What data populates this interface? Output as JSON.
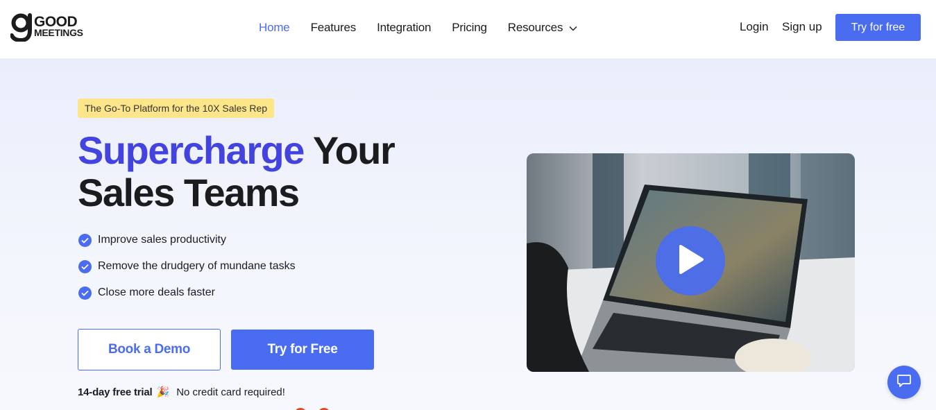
{
  "brand": {
    "line1": "GOOD",
    "line2": "MEETINGS",
    "icon": "g-logo-icon"
  },
  "nav": {
    "links": [
      {
        "label": "Home",
        "active": true
      },
      {
        "label": "Features",
        "active": false
      },
      {
        "label": "Integration",
        "active": false
      },
      {
        "label": "Pricing",
        "active": false
      },
      {
        "label": "Resources",
        "active": false,
        "icon": "chevron-down-icon"
      }
    ],
    "login": "Login",
    "signup": "Sign up",
    "cta": "Try for free"
  },
  "hero": {
    "tag": "The Go-To Platform for the 10X Sales Rep",
    "headline_accent": "Supercharge",
    "headline_rest_1": " Your",
    "headline_rest_2": "Sales Teams",
    "features": [
      "Improve sales productivity",
      "Remove the drudgery of mundane tasks",
      "Close more deals faster"
    ],
    "demo_button": "Book a Demo",
    "try_button": "Try for Free",
    "trial_bold": "14-day free trial",
    "trial_emoji": "🎉",
    "trial_note": "No credit card required!"
  },
  "video": {
    "play_icon": "play-icon"
  },
  "chat": {
    "icon": "chat-bubble-icon"
  },
  "colors": {
    "accent": "#4a6cf0",
    "headline_accent": "#4343e0",
    "tag_bg": "#fde68a"
  }
}
